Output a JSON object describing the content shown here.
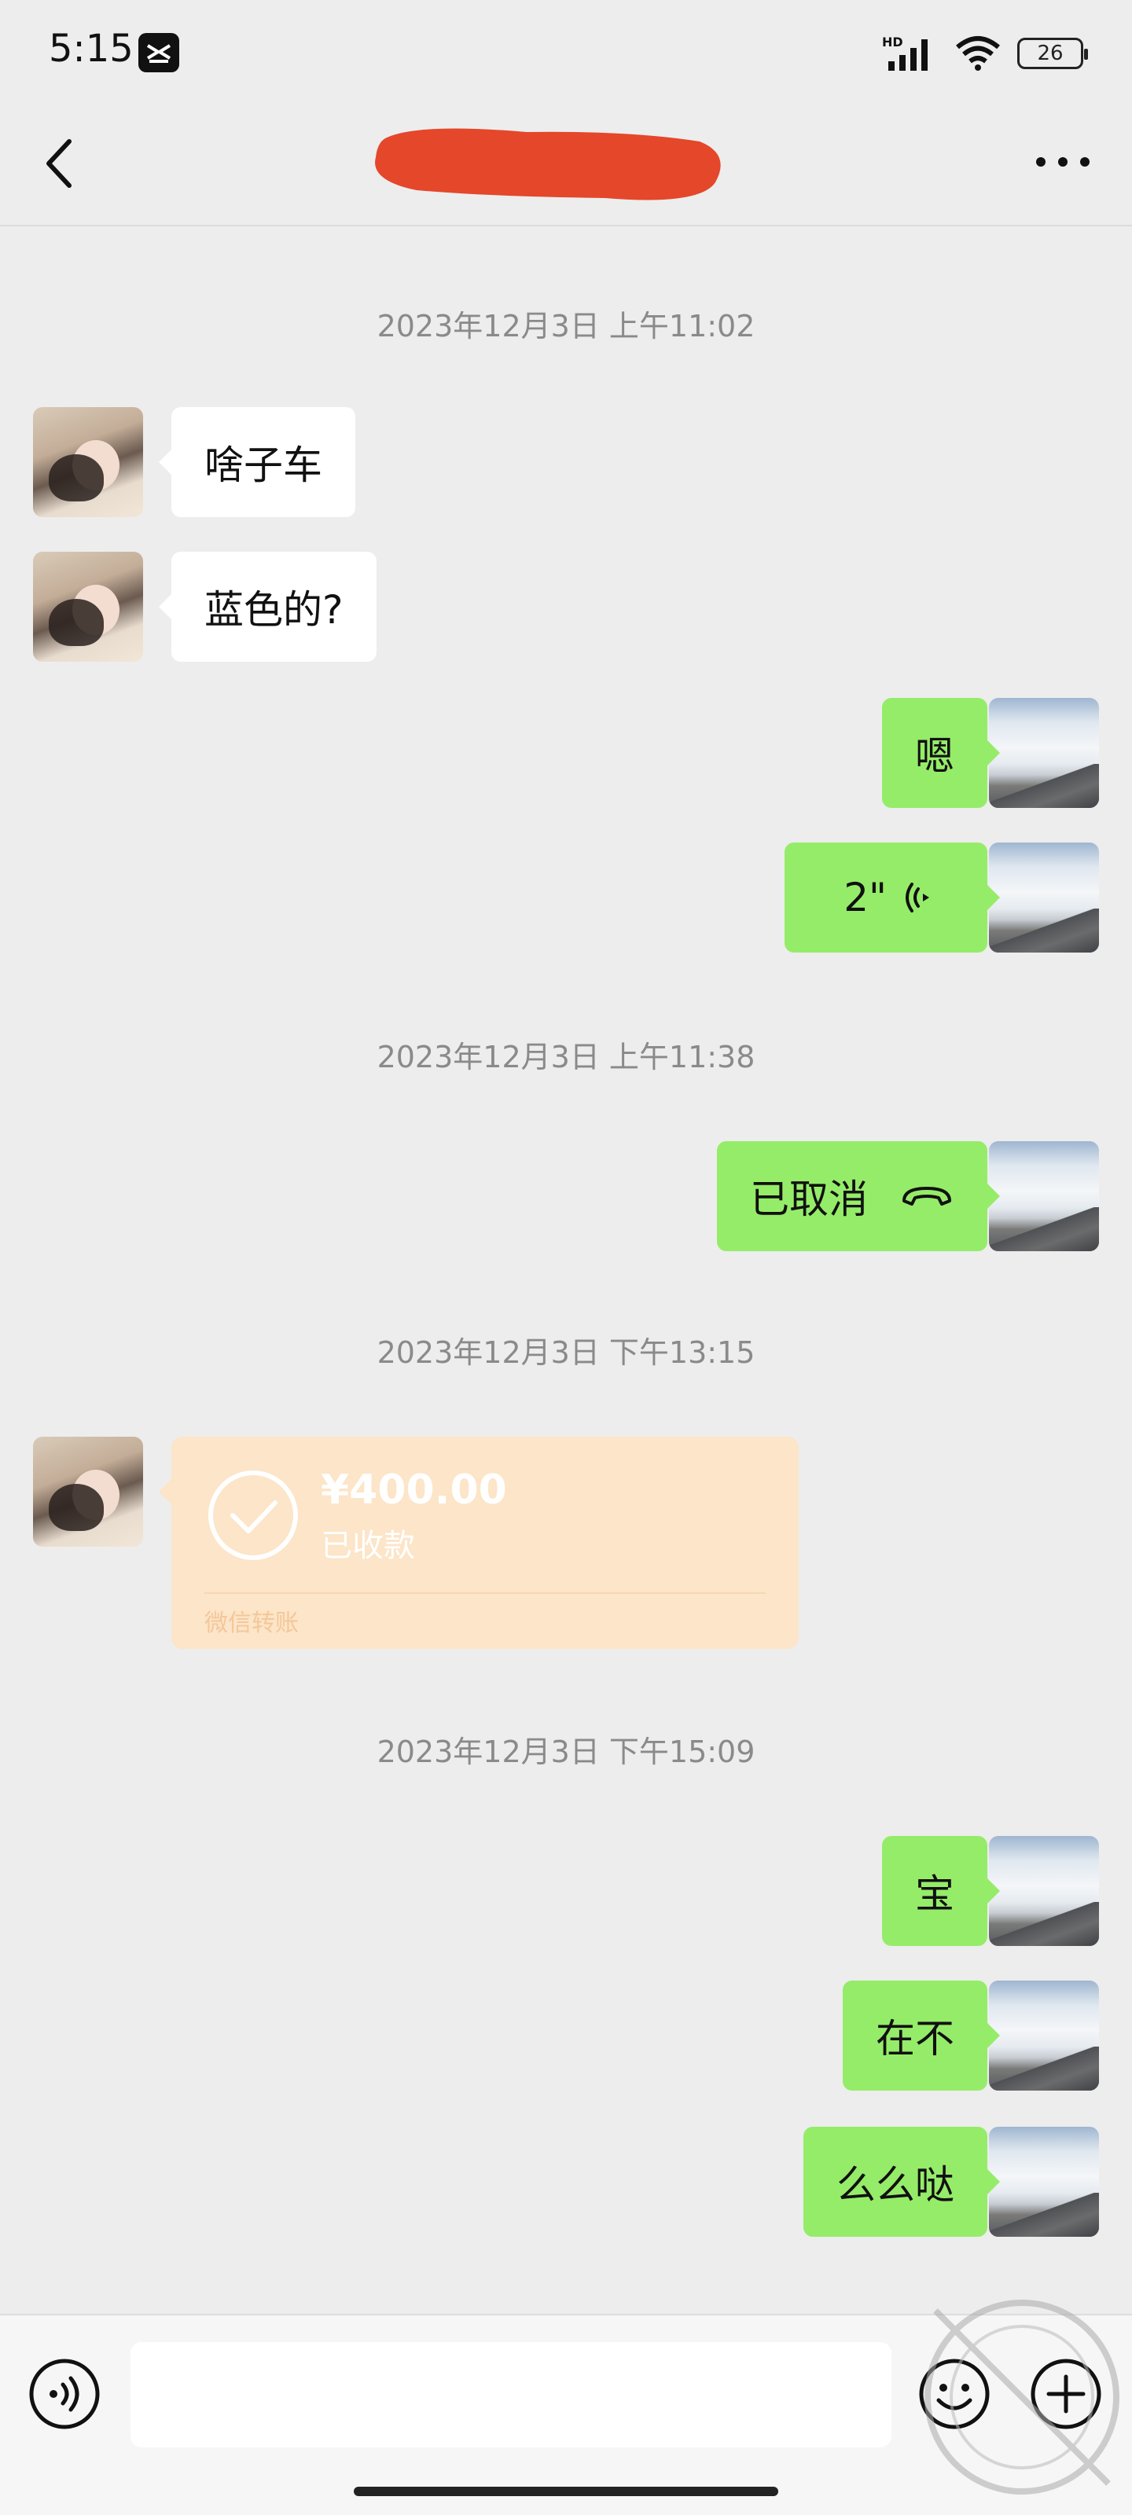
{
  "status_bar": {
    "time": "5:15",
    "network": "HD",
    "battery": "26",
    "icons": [
      "capcut-icon",
      "signal-icon",
      "wifi-icon",
      "battery-icon"
    ]
  },
  "header": {
    "contact_name_redacted": true,
    "icons": [
      "back-icon",
      "more-icon"
    ]
  },
  "messages": {
    "ts1": "2023年12月3日 上午11:02",
    "m1": "啥子车",
    "m2": "蓝色的?",
    "m3": "嗯",
    "voice_duration": "2\"",
    "ts2": "2023年12月3日 上午11:38",
    "call_status": "已取消",
    "ts3": "2023年12月3日 下午13:15",
    "transfer": {
      "amount": "¥400.00",
      "status": "已收款",
      "label": "微信转账"
    },
    "ts4": "2023年12月3日 下午15:09",
    "m4": "宝",
    "m5": "在不",
    "m6": "么么哒"
  },
  "input": {
    "placeholder": ""
  },
  "colors": {
    "background": "#ededed",
    "self_bubble": "#95ec69",
    "other_bubble": "#ffffff",
    "transfer_card": "#fce5c8",
    "redaction": "#e4472a"
  }
}
